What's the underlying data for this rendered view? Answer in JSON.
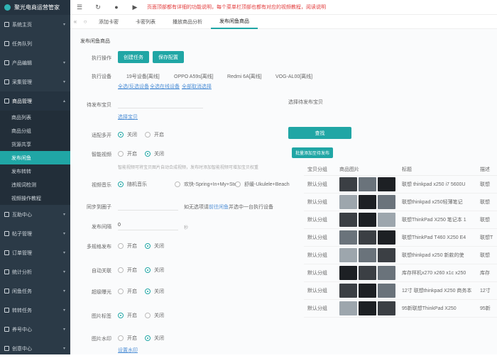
{
  "app": {
    "title": "聚光电商运营管家"
  },
  "sidebar": {
    "items": [
      {
        "label": "系统主页",
        "icon": "home-icon"
      },
      {
        "label": "任务队列",
        "icon": "list-icon"
      },
      {
        "label": "产品编辑",
        "icon": "edit-icon"
      },
      {
        "label": "采集管理",
        "icon": "download-icon"
      },
      {
        "label": "商品管理",
        "icon": "box-icon"
      }
    ],
    "submenu": [
      "商品列表",
      "商品分组",
      "货源共享",
      "发布闲鱼",
      "发布转转",
      "违规词检测",
      "视频操作教程"
    ],
    "items_after": [
      {
        "label": "互助中心",
        "icon": "help-icon"
      },
      {
        "label": "帖子管理",
        "icon": "post-icon"
      },
      {
        "label": "订单管理",
        "icon": "order-icon"
      },
      {
        "label": "统计分析",
        "icon": "chart-icon"
      },
      {
        "label": "闲鱼任务",
        "icon": "task-icon"
      },
      {
        "label": "转转任务",
        "icon": "task-icon"
      },
      {
        "label": "养号中心",
        "icon": "user-icon"
      },
      {
        "label": "创意中心",
        "icon": "idea-icon"
      }
    ]
  },
  "topbar": {
    "notice": "页面顶部都有详细的功能说明，每个菜单栏顶部也都有对应的视频教程，阅读说明"
  },
  "tabs": [
    "添加卡密",
    "卡密列表",
    "播放商品分析",
    "发布闲鱼商品"
  ],
  "form": {
    "page_title": "发布闲鱼商品",
    "exec_label": "执行操作",
    "create_task": "创建任务",
    "save_config": "保存配置",
    "device_label": "执行设备",
    "devices": [
      "19号设备[离线]",
      "OPPO A59s[离线]",
      "Redmi 6A[离线]",
      "VOG-AL00[离线]"
    ],
    "device_links": [
      "全选/反选设备",
      "全选在线设备",
      "全部取消选择"
    ],
    "shop_label": "待发布宝贝",
    "shop_link": "选择宝贝",
    "selected_label": "选择待发布宝贝",
    "multi_label": "适配多开",
    "smart_video_label": "智能视频",
    "smart_video_tip": "智能视频可将宝贝图片自动合成视频，发布时添加智能视频可增加宝贝权重",
    "music_label": "视频音乐",
    "music_options": [
      "随机音乐",
      "欢快-Spring+In+My+Step",
      "舒缓-Ukulele+Beach"
    ],
    "sync_label": "同步到圈子",
    "sync_tip_before": "如无选项请",
    "sync_tip_link": "前往闲鱼",
    "sync_tip_after": "并选中一台执行设备",
    "interval_label": "发布间隔",
    "interval_value": "0",
    "interval_unit": "秒",
    "multi_spec_label": "多规格发布",
    "auto_link_label": "自动关联",
    "super_expose_label": "超级曝光",
    "img_tag_label": "图片标签",
    "img_watermark_label": "图片水印",
    "watermark_link": "设置水印",
    "on": "开启",
    "off": "关闭",
    "search_btn": "查找",
    "batch_btn": "批量添加至待发布"
  },
  "table": {
    "headers": [
      "宝贝分组",
      "商品图片",
      "标题",
      "描述"
    ],
    "rows": [
      {
        "group": "默认分组",
        "title": "联想 thinkpad x250 i7 5600U",
        "desc": "联想"
      },
      {
        "group": "默认分组",
        "title": "联想thinkpad x250轻薄笔记",
        "desc": "联想"
      },
      {
        "group": "默认分组",
        "title": "联想ThinkPad X250 笔记本 1",
        "desc": "联想"
      },
      {
        "group": "默认分组",
        "title": "联想ThinkPad T460 X250 E4",
        "desc": "联想T"
      },
      {
        "group": "默认分组",
        "title": "联想thinkpad x250 新款的使",
        "desc": "联想"
      },
      {
        "group": "默认分组",
        "title": "库存样机x270 x260 x1c x250",
        "desc": "库存"
      },
      {
        "group": "默认分组",
        "title": "12寸 联想thinkpad X250 商务本",
        "desc": "12寸"
      },
      {
        "group": "默认分组",
        "title": "95新联想ThinkPad X250",
        "desc": "95新"
      }
    ]
  },
  "colors": {
    "accent": "#20a6a5",
    "sidebar": "#2b3a47",
    "notice": "#e23b3b"
  }
}
